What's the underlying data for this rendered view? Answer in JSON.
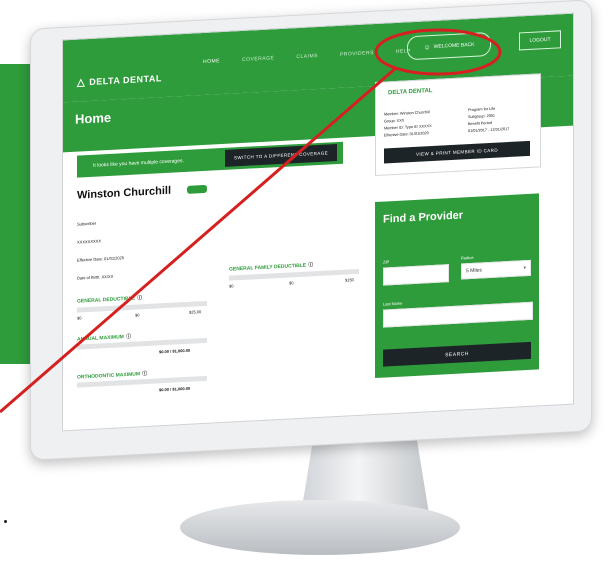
{
  "header": {
    "logo_text": "DELTA DENTAL",
    "nav": [
      "HOME",
      "COVERAGE",
      "CLAIMS",
      "PROVIDERS",
      "HELP"
    ],
    "welcome": "WELCOME BACK",
    "logout": "LOGOUT"
  },
  "page": {
    "title": "Home",
    "coverage_notice": "It looks like you have multiple coverages.",
    "switch_button": "SWITCH TO A DIFFERENT COVERAGE"
  },
  "member_card": {
    "logo": "DELTA DENTAL",
    "left_lines": [
      "Member: Winston Churchill",
      "Group: XXX",
      "Member ID: Type ID XXXXX",
      "Effective Date: 01/01/2020"
    ],
    "right_lines": [
      "Program for Life",
      "Subgroup: 2001",
      "Benefit Period",
      "01/01/2017 - 12/31/2017"
    ],
    "button": "VIEW & PRINT MEMBER ID CARD"
  },
  "member": {
    "name": "Winston Churchill",
    "lines": [
      "Subscriber",
      "XXXXXXXXX",
      "Effective Date: 01/01/2020",
      "Date of Birth: XX/XX"
    ]
  },
  "individual_deductible": {
    "title": "GENERAL DEDUCTIBLE",
    "ticks": [
      "$0",
      "$0",
      "$25.00"
    ],
    "fill_fraction": 0.0
  },
  "annual_maximum": {
    "title": "ANNUAL MAXIMUM",
    "amount": "$0.00 / $1,000.00",
    "fill_fraction": 0.0
  },
  "ortho_maximum": {
    "title": "ORTHODONTIC MAXIMUM",
    "amount": "$0.00 / $1,000.00",
    "fill_fraction": 0.0
  },
  "family_deductible": {
    "title": "GENERAL FAMILY DEDUCTIBLE",
    "ticks": [
      "$0",
      "$0",
      "$150"
    ],
    "fill_fraction": 0.0
  },
  "provider": {
    "title": "Find a Provider",
    "zip_label": "ZIP",
    "radius_label": "Radius",
    "radius_value": "5 Miles",
    "last_name_label": "Last Name",
    "search_button": "SEARCH"
  },
  "colors": {
    "brand_green": "#2e9c3b",
    "dark": "#1d2428",
    "annotation_red": "#d62020"
  }
}
